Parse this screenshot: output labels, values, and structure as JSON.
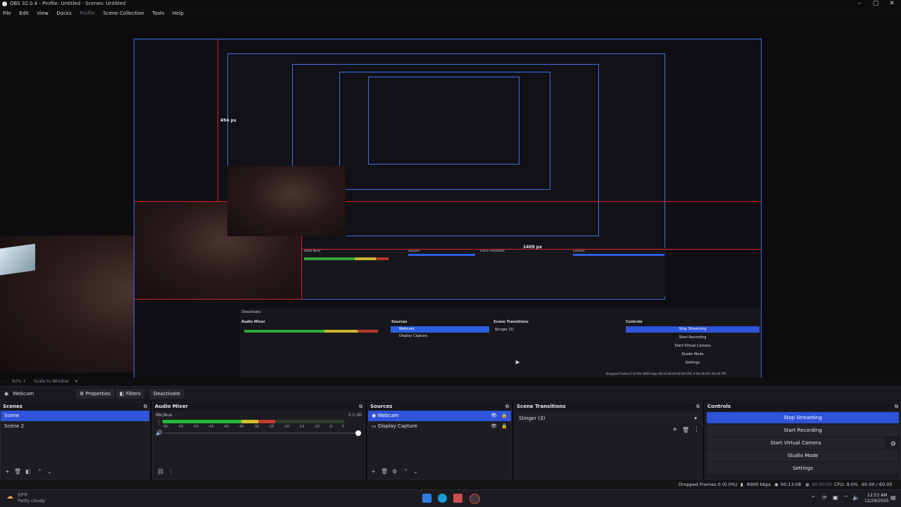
{
  "window": {
    "title": "OBS 32.0.4 - Profile: Untitled - Scenes: Untitled"
  },
  "menu": [
    "File",
    "Edit",
    "View",
    "Docks",
    "Profile",
    "Scene Collection",
    "Tools",
    "Help"
  ],
  "preview": {
    "label_height": "494 px",
    "label_height_inner": "494 px",
    "label_width": "1409 px",
    "label_width_inner": "1409 px",
    "nested_deactivate_label": "Deactivate",
    "nested_audio": "Audio Mixer",
    "nested_sources": "Sources",
    "nested_transitions": "Scene Transitions",
    "nested_controls": "Controls",
    "nested_src1": "Webcam",
    "nested_src2": "Display Capture",
    "nested_transition": "Stinger (3)",
    "nested_ctrl": [
      "Stop Streaming",
      "Start Recording",
      "Start Virtual Camera",
      "Studio Mode",
      "Settings"
    ],
    "nested_status": "Dropped Frames 0 (0.0%)   8900 kbps   00:13:08   00:00:00   CPU: 9.0%   60.00 / 60.00 FPS"
  },
  "zoom": {
    "percent": "92%",
    "mode": "Scale to Window"
  },
  "source_toolbar": {
    "source_name": "Webcam",
    "properties": "Properties",
    "filters": "Filters",
    "deactivate": "Deactivate"
  },
  "scenes": {
    "title": "Scenes",
    "items": [
      "Scene",
      "Scene 2"
    ]
  },
  "audio_mixer": {
    "title": "Audio Mixer",
    "channel": "Mic/Aux",
    "db": "0.0 dB",
    "ticks": [
      "-60",
      "-55",
      "-50",
      "-45",
      "-40",
      "-35",
      "-30",
      "-25",
      "-20",
      "-15",
      "-10",
      "-5",
      "0"
    ],
    "level": 0.62
  },
  "sources": {
    "title": "Sources",
    "items": [
      "Webcam",
      "Display Capture"
    ]
  },
  "transitions": {
    "title": "Scene Transitions",
    "selected": "Stinger (3)"
  },
  "controls": {
    "title": "Controls",
    "stop_streaming": "Stop Streaming",
    "start_recording": "Start Recording",
    "start_virtual_camera": "Start Virtual Camera",
    "studio_mode": "Studio Mode",
    "settings": "Settings"
  },
  "status": {
    "dropped": "Dropped Frames 0 (0.0%)",
    "bitrate": "8900 kbps",
    "stream_time": "00:13:08",
    "rec_time": "00:00:00",
    "cpu": "CPU: 9.0%",
    "fps": "60.00 / 60.00 FPS"
  },
  "taskbar": {
    "weather_temp": "57°F",
    "weather_desc": "Partly cloudy",
    "time": "12:53 AM",
    "date": "12/29/2025"
  },
  "colors": {
    "accent": "#2f53d9",
    "guide_red": "#d91f2a",
    "canvas_border": "#3f6fe0"
  }
}
